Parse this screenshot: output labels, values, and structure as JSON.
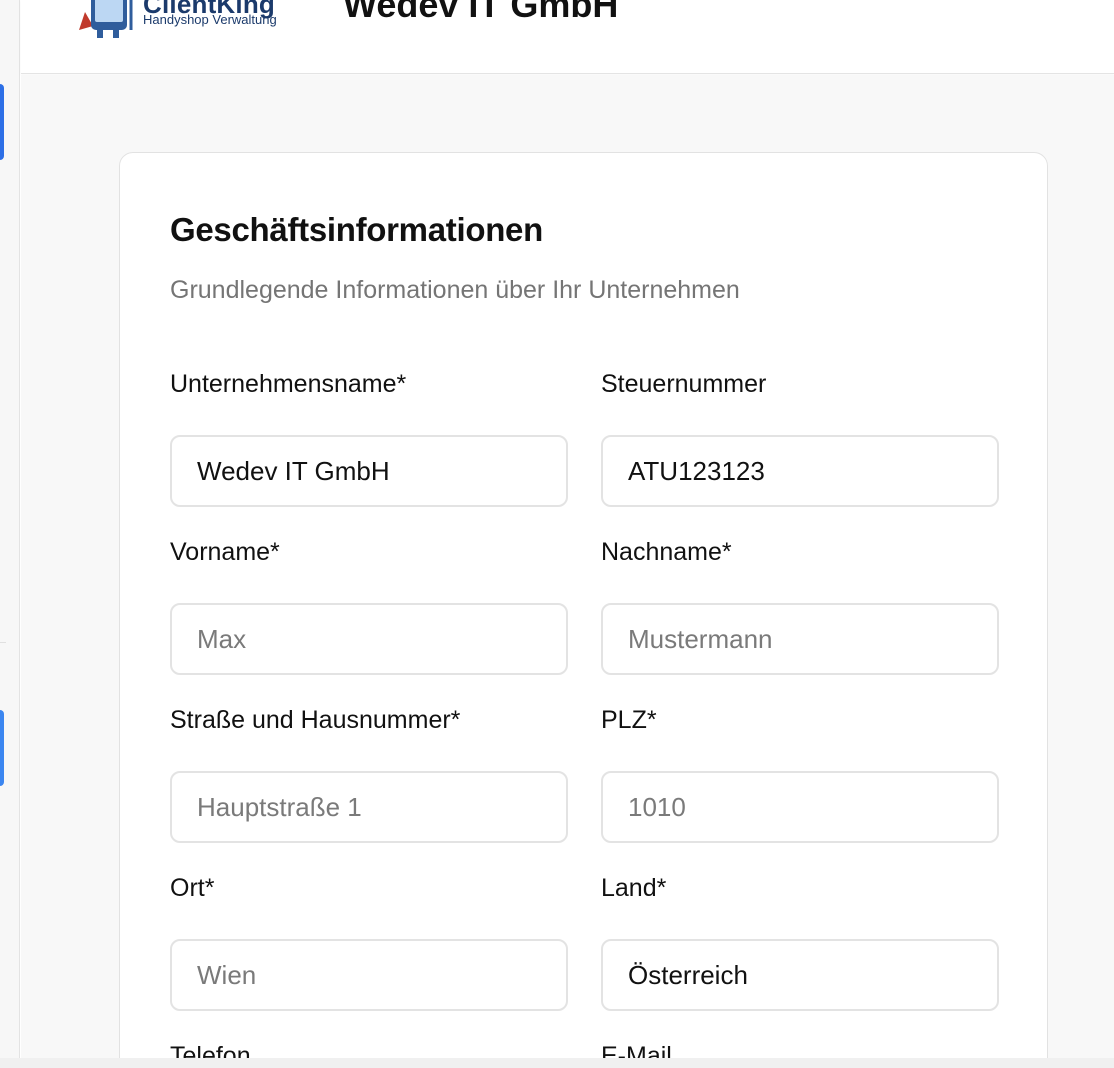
{
  "header": {
    "logo": {
      "name": "ClientKing",
      "subtitle": "Handyshop Verwaltung"
    },
    "company_title": "Wedev IT GmbH"
  },
  "card": {
    "title": "Geschäftsinformationen",
    "description": "Grundlegende Informationen über Ihr Unternehmen",
    "fields": {
      "company_name": {
        "label": "Unternehmensname*",
        "value": "Wedev IT GmbH",
        "placeholder": ""
      },
      "tax_number": {
        "label": "Steuernummer",
        "value": "ATU123123",
        "placeholder": ""
      },
      "first_name": {
        "label": "Vorname*",
        "value": "",
        "placeholder": "Max"
      },
      "last_name": {
        "label": "Nachname*",
        "value": "",
        "placeholder": "Mustermann"
      },
      "street": {
        "label": "Straße und Hausnummer*",
        "value": "",
        "placeholder": "Hauptstraße 1"
      },
      "zip": {
        "label": "PLZ*",
        "value": "",
        "placeholder": "1010"
      },
      "city": {
        "label": "Ort*",
        "value": "",
        "placeholder": "Wien"
      },
      "country": {
        "label": "Land*",
        "value": "Österreich",
        "placeholder": ""
      },
      "phone": {
        "label": "Telefon"
      },
      "email": {
        "label": "E-Mail"
      }
    }
  },
  "colors": {
    "accent": "#2d6fe6",
    "brand_text": "#1b3a6b",
    "muted_text": "#757575",
    "page_bg": "#f8f8f8",
    "border": "#e3e3e3"
  },
  "icons": {
    "logo": "king-phone-mascot-icon"
  }
}
